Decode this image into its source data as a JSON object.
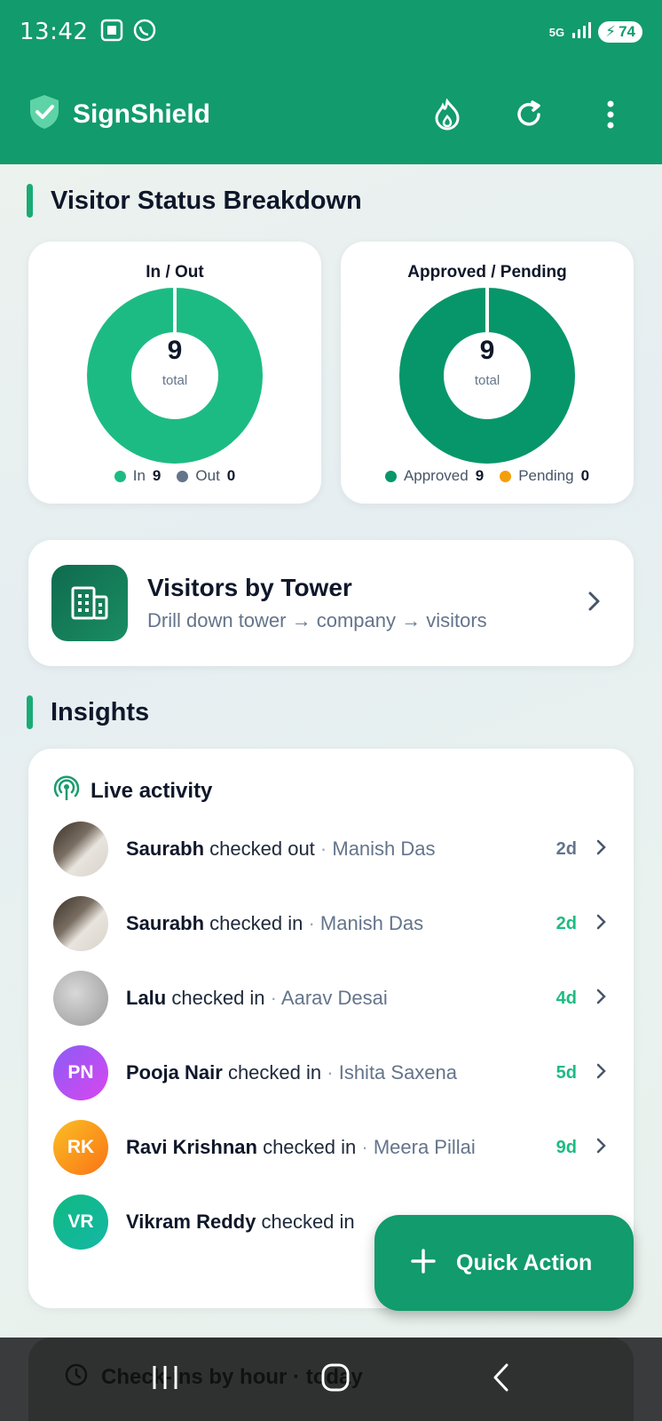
{
  "status_bar": {
    "time": "13:42",
    "network": "5G",
    "battery": "74"
  },
  "app_bar": {
    "title": "SignShield"
  },
  "visitor_status": {
    "heading": "Visitor Status Breakdown",
    "charts": [
      {
        "title": "In / Out",
        "total": "9",
        "total_label": "total",
        "legend": [
          {
            "label": "In",
            "value": "9",
            "color": "#1dbb84"
          },
          {
            "label": "Out",
            "value": "0",
            "color": "#64748b"
          }
        ]
      },
      {
        "title": "Approved / Pending",
        "total": "9",
        "total_label": "total",
        "legend": [
          {
            "label": "Approved",
            "value": "9",
            "color": "#079669"
          },
          {
            "label": "Pending",
            "value": "0",
            "color": "#f59e0b"
          }
        ]
      }
    ]
  },
  "tower_card": {
    "title": "Visitors by Tower",
    "subtitle": "Drill down tower → company → visitors"
  },
  "insights": {
    "heading": "Insights",
    "live_title": "Live activity",
    "rows": [
      {
        "name": "Saurabh",
        "action": "checked out",
        "host": "Manish Das",
        "time": "2d",
        "avatar": "photo",
        "time_color": "#64748b"
      },
      {
        "name": "Saurabh",
        "action": "checked in",
        "host": "Manish Das",
        "time": "2d",
        "avatar": "photo",
        "time_color": "#1dbb84"
      },
      {
        "name": "Lalu",
        "action": "checked in",
        "host": "Aarav Desai",
        "time": "4d",
        "avatar": "photo-grey",
        "time_color": "#1dbb84"
      },
      {
        "name": "Pooja Nair",
        "action": "checked in",
        "host": "Ishita Saxena",
        "time": "5d",
        "avatar": "PN",
        "time_color": "#1dbb84"
      },
      {
        "name": "Ravi Krishnan",
        "action": "checked in",
        "host": "Meera Pillai",
        "time": "9d",
        "avatar": "RK",
        "time_color": "#1dbb84"
      },
      {
        "name": "Vikram Reddy",
        "action": "checked in",
        "host": "",
        "time": "",
        "avatar": "VR",
        "time_color": "#1dbb84"
      }
    ]
  },
  "fab": {
    "label": "Quick Action"
  },
  "bottom_card": {
    "label": "Check-ins by hour · today"
  },
  "colors": {
    "brand": "#129b6c",
    "accent": "#1dbb84",
    "approved": "#079669",
    "pending": "#f59e0b"
  }
}
